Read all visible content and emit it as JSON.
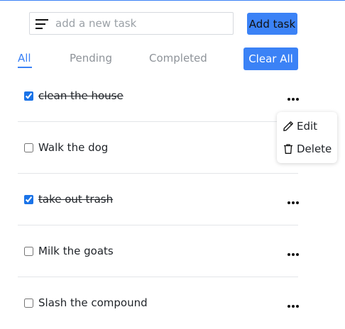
{
  "input": {
    "placeholder": "add a new task",
    "value": ""
  },
  "add_button_label": "Add task",
  "filters": {
    "all": "All",
    "pending": "Pending",
    "completed": "Completed",
    "active": "all"
  },
  "clear_all_label": "Clear All",
  "tasks": [
    {
      "label": "clean the house",
      "completed": true
    },
    {
      "label": "Walk the dog",
      "completed": false
    },
    {
      "label": "take out trash",
      "completed": true
    },
    {
      "label": "Milk the goats",
      "completed": false
    },
    {
      "label": "Slash the compound",
      "completed": false
    }
  ],
  "context_menu": {
    "edit_label": "Edit",
    "delete_label": "Delete"
  },
  "colors": {
    "accent": "#3b82f6",
    "divider": "#e3e5e8"
  }
}
